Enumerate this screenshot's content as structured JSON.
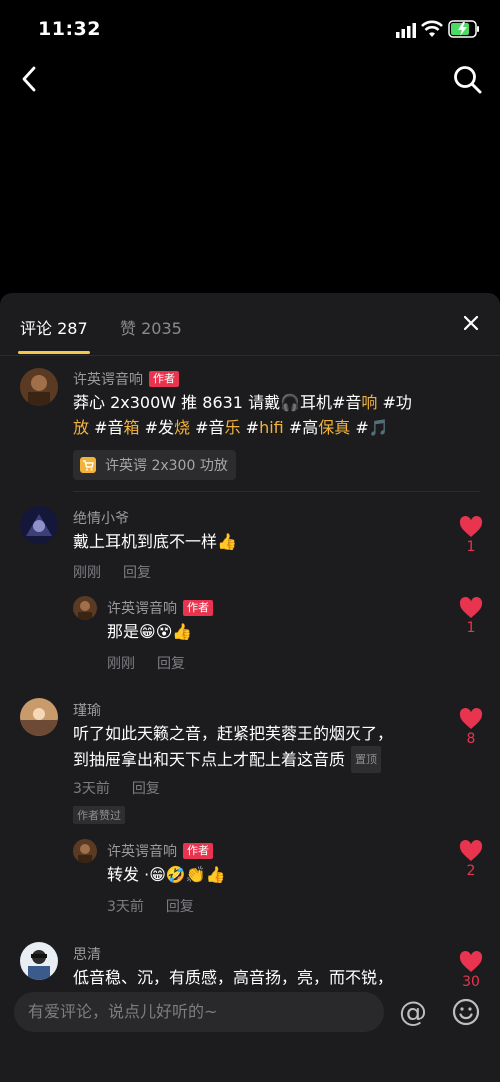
{
  "status_bar": {
    "time": "11:32"
  },
  "tabs": {
    "comments": "评论 287",
    "likes": "赞 2035"
  },
  "comments": [
    {
      "user": "许英谔音响",
      "badge": "作者",
      "text_parts": [
        "莽心 2x300W 推 8631 请戴",
        "🎧",
        "耳机#音",
        "响",
        " #功",
        "放",
        " #音",
        "箱",
        " #发",
        "烧",
        " #音",
        "乐",
        " #",
        "hifi",
        " #高",
        "保真",
        " #",
        "🎵"
      ],
      "product": "许英谔 2x300 功放"
    },
    {
      "user": "绝情小爷",
      "text": "戴上耳机到底不一样",
      "emoji": "👍",
      "time": "刚刚",
      "reply": "回复",
      "likes": "1",
      "replies": [
        {
          "user": "许英谔音响",
          "badge": "作者",
          "text": "那是",
          "emoji": "😁😵👍",
          "time": "刚刚",
          "reply": "回复",
          "likes": "1"
        }
      ]
    },
    {
      "user": "瑾瑜",
      "line1": "听了如此天籁之音，赶紧把芙蓉王的烟灭了，",
      "line2": "到抽屉拿出和天下点上才配上着这音质",
      "pinned": "置顶",
      "time": "3天前",
      "reply": "回复",
      "author_liked": "作者赞过",
      "likes": "8",
      "replies": [
        {
          "user": "许英谔音响",
          "badge": "作者",
          "text": "转发 ·",
          "emoji": "😁🤣👏👍",
          "time": "3天前",
          "reply": "回复",
          "likes": "2"
        }
      ]
    },
    {
      "user": "思清",
      "text": "低音稳、沉，有质感，高音扬，亮，而不锐，",
      "likes": "30"
    }
  ],
  "input": {
    "placeholder": "有爱评论，说点儿好听的~",
    "at": "@"
  },
  "colors": {
    "accent_yellow": "#f2c94c",
    "heart_red": "#e8344e",
    "sheet_bg": "#1c1c1e"
  }
}
